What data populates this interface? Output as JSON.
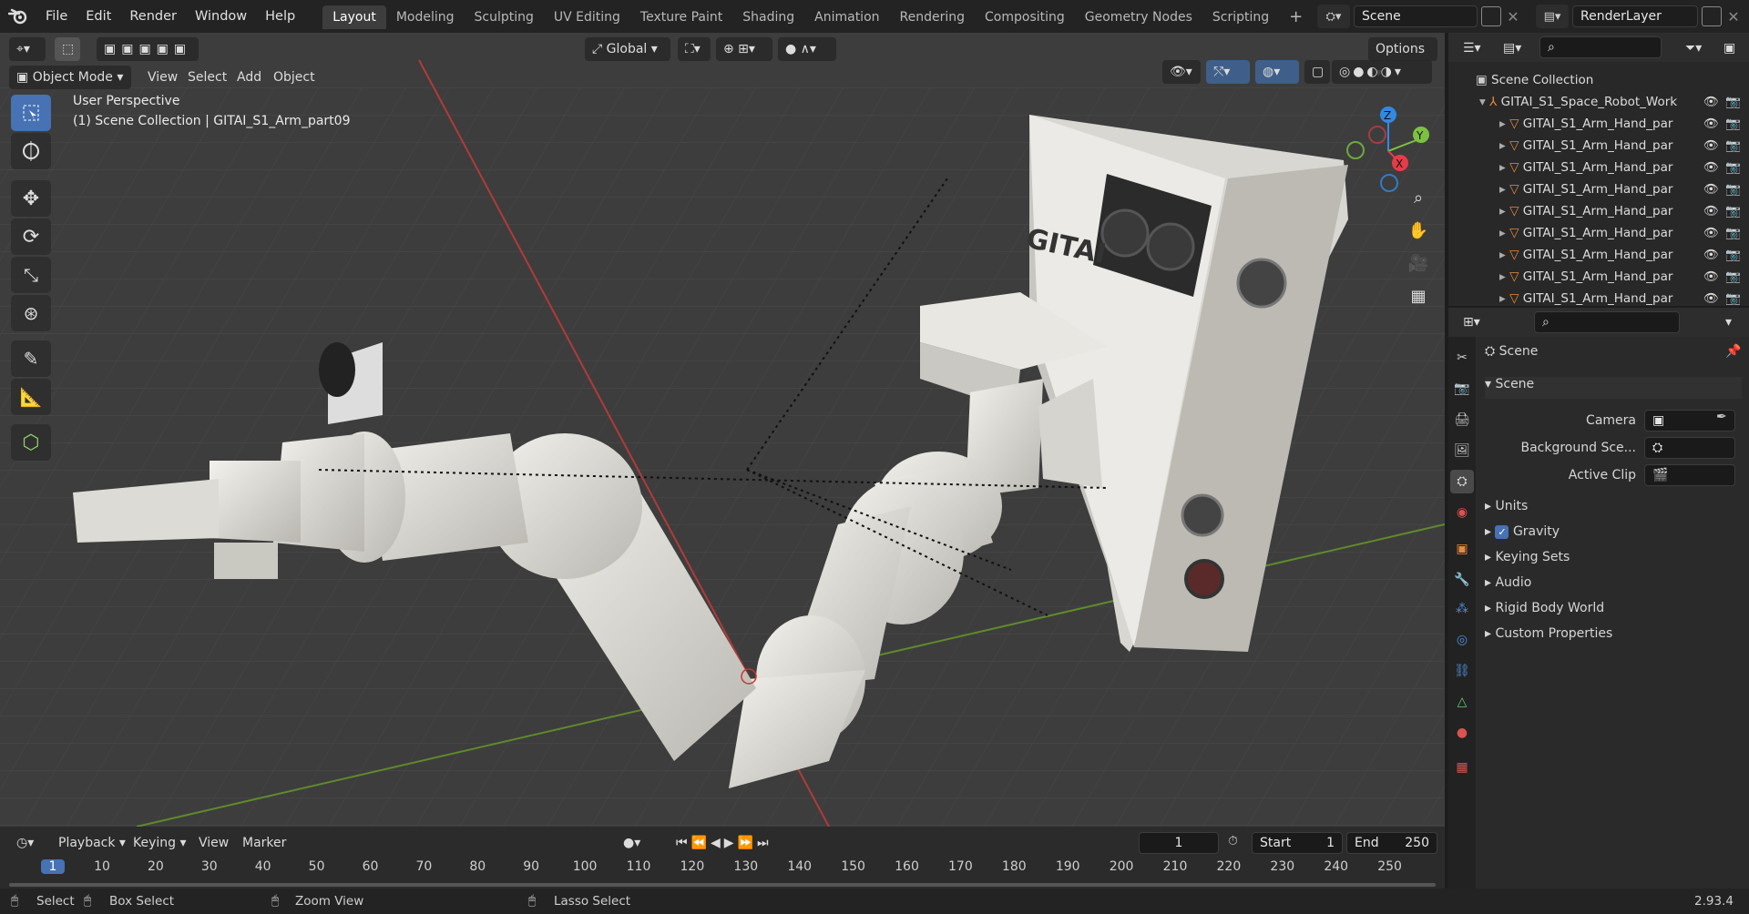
{
  "menubar": {
    "items": [
      "File",
      "Edit",
      "Render",
      "Window",
      "Help"
    ],
    "workspaces": [
      "Layout",
      "Modeling",
      "Sculpting",
      "UV Editing",
      "Texture Paint",
      "Shading",
      "Animation",
      "Rendering",
      "Compositing",
      "Geometry Nodes",
      "Scripting"
    ],
    "active_workspace": "Layout",
    "scene_name": "Scene",
    "view_layer": "RenderLayer"
  },
  "viewport": {
    "transform_orientation": "Global",
    "options_label": "Options",
    "mode": "Object Mode",
    "menus": [
      "View",
      "Select",
      "Add",
      "Object"
    ],
    "overlay_line1": "User Perspective",
    "overlay_line2": "(1) Scene Collection | GITAI_S1_Arm_part09",
    "gizmo": {
      "x": "X",
      "y": "Y",
      "z": "Z"
    },
    "logo_text": "GITAI"
  },
  "outliner": {
    "root": "Scene Collection",
    "parent": "GITAI_S1_Space_Robot_Work",
    "children": [
      "GITAI_S1_Arm_Hand_par",
      "GITAI_S1_Arm_Hand_par",
      "GITAI_S1_Arm_Hand_par",
      "GITAI_S1_Arm_Hand_par",
      "GITAI_S1_Arm_Hand_par",
      "GITAI_S1_Arm_Hand_par",
      "GITAI_S1_Arm_Hand_par",
      "GITAI_S1_Arm_Hand_par",
      "GITAI_S1_Arm_Hand_par"
    ]
  },
  "properties": {
    "context": "Scene",
    "panel_title": "Scene",
    "camera_label": "Camera",
    "background_label": "Background Sce...",
    "active_clip_label": "Active Clip",
    "sections": [
      "Units",
      "Gravity",
      "Keying Sets",
      "Audio",
      "Rigid Body World",
      "Custom Properties"
    ],
    "gravity_checked": true
  },
  "timeline": {
    "playback": "Playback",
    "keying": "Keying",
    "view": "View",
    "marker": "Marker",
    "current_frame": "1",
    "start_label": "Start",
    "start": "1",
    "end_label": "End",
    "end": "250",
    "ruler": [
      "1",
      "10",
      "20",
      "30",
      "40",
      "50",
      "60",
      "70",
      "80",
      "90",
      "100",
      "110",
      "120",
      "130",
      "140",
      "150",
      "160",
      "170",
      "180",
      "190",
      "200",
      "210",
      "220",
      "230",
      "240",
      "250"
    ]
  },
  "statusbar": {
    "select": "Select",
    "box_select": "Box Select",
    "zoom_view": "Zoom View",
    "lasso_select": "Lasso Select",
    "version": "2.93.4"
  },
  "colors": {
    "accent": "#4772b3",
    "x_axis": "#e63c4a",
    "y_axis": "#7cc240",
    "z_axis": "#2f8ae6"
  }
}
